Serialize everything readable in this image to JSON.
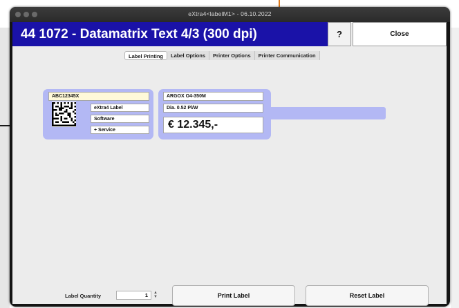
{
  "window": {
    "title": "eXtra4<labelM1> - 06.10.2022"
  },
  "header": {
    "title": "44 1072 - Datamatrix Text 4/3 (300 dpi)",
    "help_label": "?",
    "close_label": "Close"
  },
  "tabs": [
    {
      "label": "Label Printing",
      "active": true
    },
    {
      "label": "Label Options",
      "active": false
    },
    {
      "label": "Printer Options",
      "active": false
    },
    {
      "label": "Printer Communication",
      "active": false
    }
  ],
  "label_preview": {
    "barcode_text": "ABC12345X",
    "lines": [
      "eXtra4 Label",
      "Software",
      "+ Service"
    ]
  },
  "printer_info": {
    "printer": "ARGOX O4-350M",
    "ribbon": "Dia. 0.52 Pl/W",
    "price": "€ 12.345,-"
  },
  "footer": {
    "quantity_label": "Label Quantity",
    "quantity_value": "1",
    "print_label": "Print Label",
    "reset_label": "Reset Label"
  },
  "colors": {
    "header_bg": "#1a12a8",
    "panel_bg": "#b3b8f4",
    "barcode_field_bg": "#fff9d9"
  }
}
